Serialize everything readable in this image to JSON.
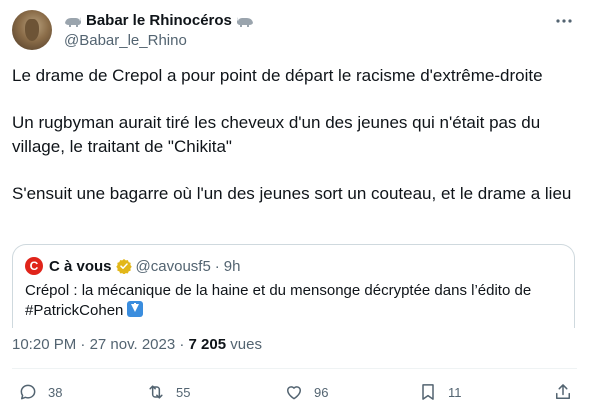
{
  "tweet": {
    "author_name": "Babar le Rhinocéros",
    "author_handle": "@Babar_le_Rhino",
    "paragraphs": [
      "Le drame de Crepol a pour point de départ le racisme d'extrême-droite",
      "Un rugbyman aurait tiré les cheveux d'un des jeunes qui n'était pas du village, le traitant de \"Chikita\"",
      "S'ensuit une bagarre où l'un des jeunes sort un couteau, et le drame a lieu"
    ],
    "time": "10:20 PM",
    "date": "27 nov. 2023",
    "separator": "·",
    "views_count": "7 205",
    "views_label": "vues"
  },
  "quote": {
    "logo_letter": "C",
    "name": "C à vous",
    "handle": "@cavousf5",
    "dot": "·",
    "age": "9h",
    "text": "Crépol : la mécanique de la haine et du mensonge décryptée dans l’édito de #PatrickCohen"
  },
  "actions": {
    "replies": "38",
    "retweets": "55",
    "likes": "96",
    "bookmarks": "11"
  },
  "colors": {
    "text": "#0f1419",
    "secondary": "#536471",
    "border": "#cfd9de",
    "verified_gold": "#e2b719",
    "quote_logo_red": "#e0241a"
  },
  "icons": [
    "rhino-emoji-icon",
    "more-icon",
    "verified-badge-icon",
    "down-arrow-emoji-icon",
    "reply-icon",
    "retweet-icon",
    "like-icon",
    "bookmark-icon",
    "share-icon"
  ]
}
